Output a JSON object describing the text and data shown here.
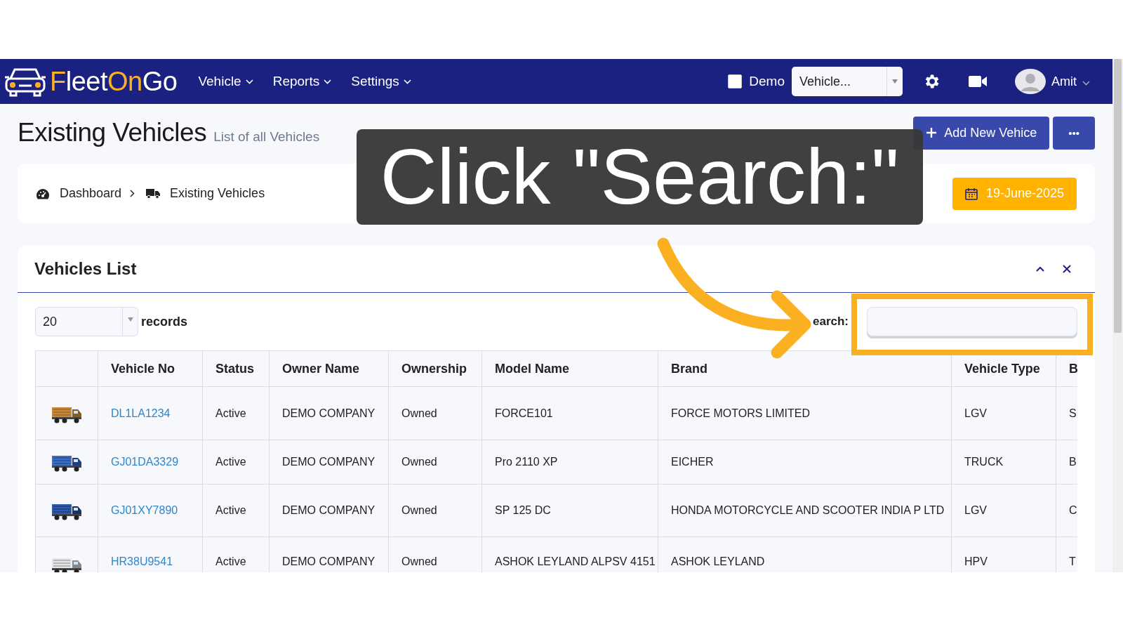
{
  "navbar": {
    "logo": [
      {
        "text": "F",
        "color": "#fbb022"
      },
      {
        "text": "leet",
        "color": "#ffffff"
      },
      {
        "text": "On",
        "color": "#fbb022"
      },
      {
        "text": "Go",
        "color": "#ffffff"
      }
    ],
    "menus": [
      "Vehicle",
      "Reports",
      "Settings"
    ],
    "demo": {
      "label": "Demo",
      "checked": false
    },
    "vehicle_select": {
      "value": "Vehicle..."
    },
    "user": "Amit"
  },
  "header": {
    "title": "Existing Vehicles",
    "subtitle": "List of all Vehicles",
    "buttons": [
      {
        "kind": "add",
        "label": "Add New Vehice"
      },
      {
        "kind": "more",
        "label": "•••"
      }
    ]
  },
  "breadcrumb": {
    "items": [
      {
        "kind": "dashboard",
        "label": "Dashboard"
      },
      {
        "kind": "truck",
        "label": "Existing Vehicles"
      }
    ],
    "date": "19-June-2025"
  },
  "panel": {
    "title": "Vehicles List",
    "page_size": "20",
    "records_label": "records",
    "search_label": "earch:",
    "table": {
      "columns": [
        "",
        "Vehicle No",
        "Status",
        "Owner Name",
        "Ownership",
        "Model Name",
        "Brand",
        "Vehicle Type",
        "B"
      ],
      "rows": [
        {
          "cells": [
            "",
            "DL1LA1234",
            "Active",
            "DEMO COMPANY",
            "Owned",
            "FORCE101",
            "FORCE MOTORS LIMITED",
            "LGV",
            "S"
          ]
        },
        {
          "cells": [
            "",
            "GJ01DA3329",
            "Active",
            "DEMO COMPANY",
            "Owned",
            "Pro 2110 XP",
            "EICHER",
            "TRUCK",
            "B"
          ]
        },
        {
          "cells": [
            "",
            "GJ01XY7890",
            "Active",
            "DEMO COMPANY",
            "Owned",
            "SP 125 DC",
            "HONDA MOTORCYCLE AND SCOOTER INDIA P LTD",
            "LGV",
            "C"
          ]
        },
        {
          "cells": [
            "",
            "HR38U9541",
            "Active",
            "DEMO COMPANY",
            "Owned",
            "ASHOK LEYLAND ALPSV 4151",
            "ASHOK LEYLAND",
            "HPV",
            "T"
          ]
        }
      ]
    }
  },
  "callout": {
    "text": "Click \"Search:\""
  }
}
